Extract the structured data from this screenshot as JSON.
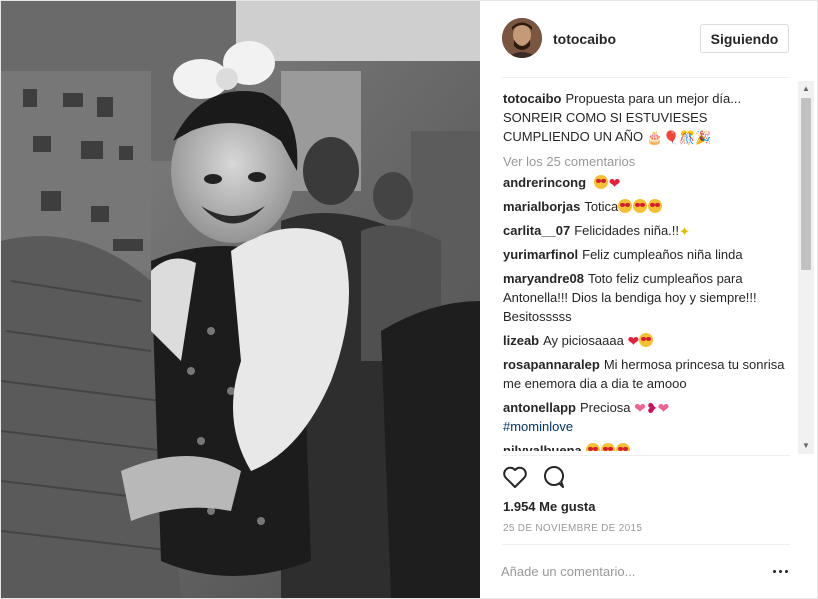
{
  "post": {
    "username": "totocaibo",
    "follow_label": "Siguiendo",
    "caption": "Propuesta para un mejor día... SONREIR COMO SI ESTUVIESES CUMPLIENDO UN AÑO",
    "caption_emoji": "🎂🎈🎊🎉",
    "view_all_comments": "Ver los 25 comentarios",
    "likes": "1.954 Me gusta",
    "date": "25 DE NOVIEMBRE DE 2015",
    "add_comment_placeholder": "Añade un comentario...",
    "image_description_icon": "photo"
  },
  "comments": [
    {
      "user": "andrerincong",
      "text": "",
      "emoji": "😍❤️"
    },
    {
      "user": "marialborjas",
      "text": "Totica",
      "emoji": "😍😍😍"
    },
    {
      "user": "carlita__07",
      "text": "Felicidades niña.!!",
      "emoji": "✨"
    },
    {
      "user": "yurimarfinol",
      "text": "Feliz cumpleaños niña linda",
      "emoji": ""
    },
    {
      "user": "maryandre08",
      "text": "Toto feliz cumpleaños para Antonella!!! Dios la bendiga hoy y siempre!!! Besitosssss",
      "emoji": ""
    },
    {
      "user": "lizeab",
      "text": "Ay piciosaaaa",
      "emoji": "❤️😍"
    },
    {
      "user": "rosapannaralep",
      "text": "Mi hermosa princesa tu sonrisa me enemora dia a dia te amooo",
      "emoji": ""
    },
    {
      "user": "antonellapp",
      "text": "Preciosa",
      "emoji": "💗💋💗",
      "hashtag": "#mominlove"
    },
    {
      "user": "nilyvalbuena",
      "text": "",
      "emoji": "😍😍😍"
    }
  ],
  "colors": {
    "link": "#003569",
    "muted": "#999999",
    "text": "#262626",
    "border": "#efefef"
  }
}
